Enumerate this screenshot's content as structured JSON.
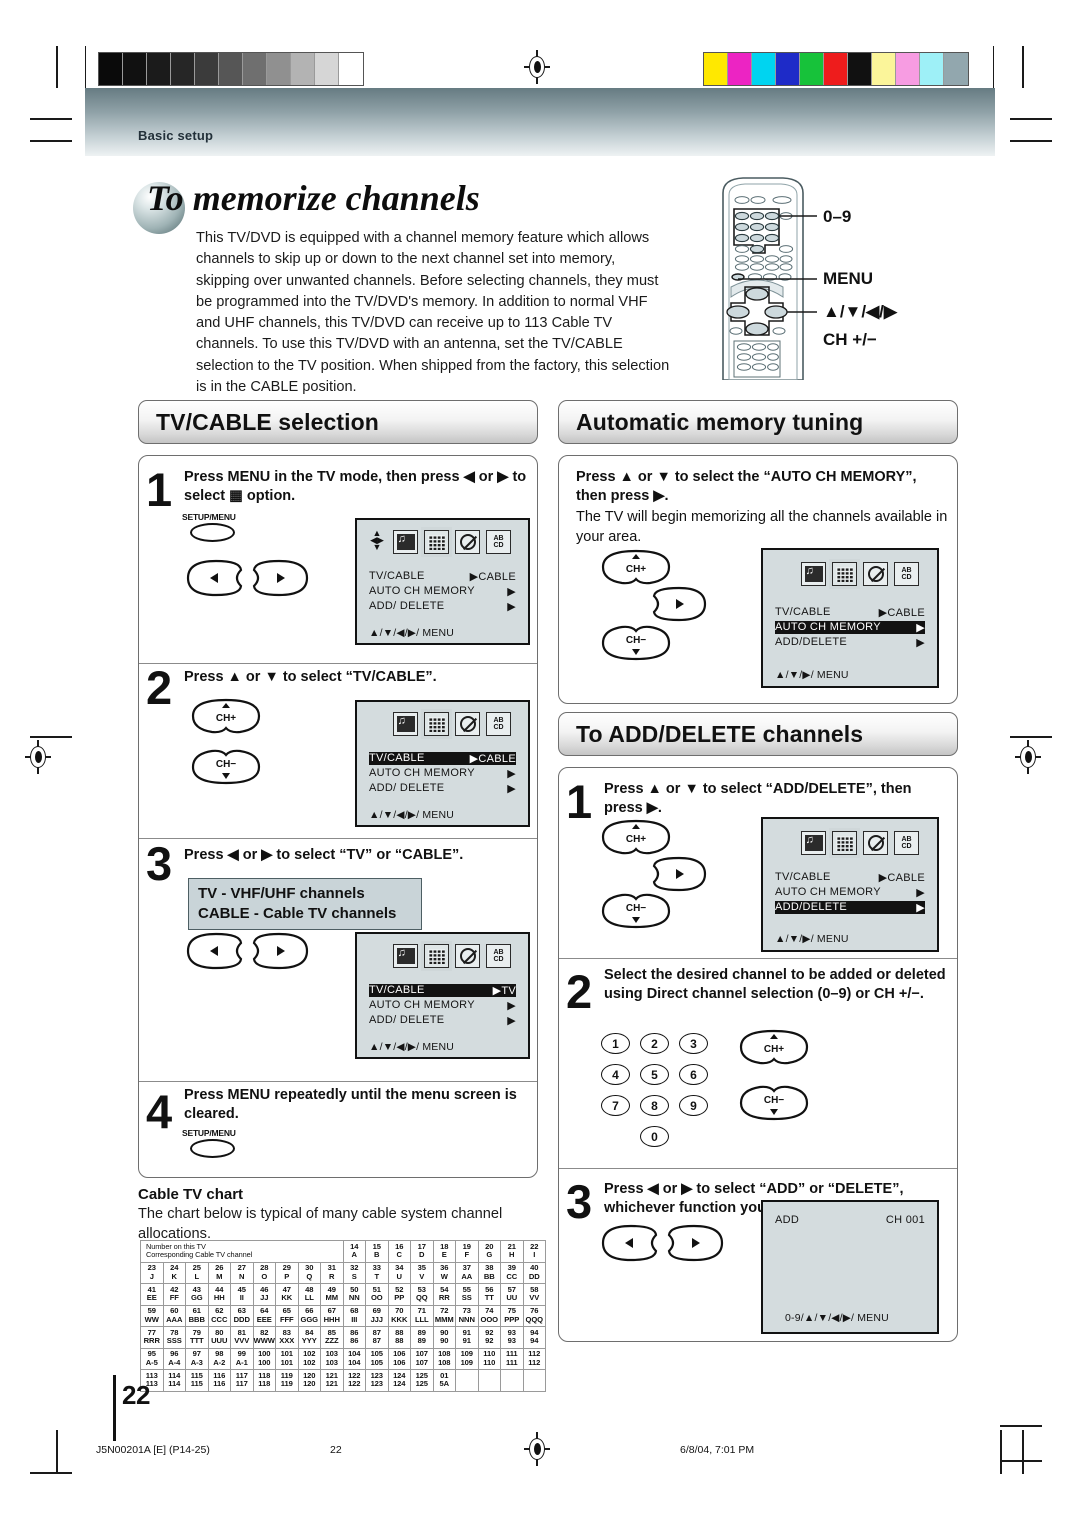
{
  "page": {
    "running_head": "Basic setup",
    "number": "22",
    "footer_left": "J5N00201A [E] (P14-25)",
    "footer_center": "22",
    "footer_right": "6/8/04, 7:01 PM"
  },
  "title": {
    "lead": "To",
    "rest": "memorize channels"
  },
  "intro": "This TV/DVD is equipped with a channel memory feature which allows channels to skip up or down to the next channel set into memory, skipping over unwanted channels. Before selecting channels, they must be programmed into the TV/DVD's memory. In addition to normal VHF and UHF channels, this TV/DVD can receive up to 113 Cable TV channels. To use this TV/DVD with an antenna, set the TV/CABLE selection to the TV position. When shipped from the factory, this selection is in the CABLE position.",
  "remote_callouts": [
    "0–9",
    "MENU",
    "▲/▼/◀/▶",
    "CH +/−"
  ],
  "sections": {
    "tv_cable": {
      "heading": "TV/CABLE selection",
      "steps": [
        {
          "num": "1",
          "text": "Press MENU in the TV mode, then press ◀ or ▶ to select ▦ option.",
          "key_label": "SETUP/MENU",
          "keys": [
            "◀",
            "▶"
          ],
          "osd": {
            "rows": [
              {
                "label": "TV/CABLE",
                "value": "▶CABLE",
                "highlight": false
              },
              {
                "label": "AUTO  CH  MEMORY",
                "value": "▶",
                "highlight": false
              },
              {
                "label": "ADD/ DELETE",
                "value": "▶",
                "highlight": false
              }
            ],
            "footer": "▲/▼/◀/▶/ MENU",
            "selected_icon": 1,
            "show_dpad": true
          }
        },
        {
          "num": "2",
          "text": "Press ▲ or ▼ to select “TV/CABLE”.",
          "keys": [
            "CH+",
            "CH−"
          ],
          "osd": {
            "rows": [
              {
                "label": "TV/CABLE",
                "value": "▶CABLE",
                "highlight": true
              },
              {
                "label": "AUTO  CH  MEMORY",
                "value": "▶",
                "highlight": false
              },
              {
                "label": "ADD/ DELETE",
                "value": "▶",
                "highlight": false
              }
            ],
            "footer": "▲/▼/◀/▶/ MENU",
            "selected_icon": 1,
            "show_dpad": false
          }
        },
        {
          "num": "3",
          "text": "Press ◀ or ▶ to select “TV” or “CABLE”.",
          "callout_lines": [
            "TV - VHF/UHF channels",
            "CABLE - Cable TV channels"
          ],
          "keys": [
            "◀",
            "▶"
          ],
          "osd": {
            "rows": [
              {
                "label": "TV/CABLE",
                "value": "▶TV",
                "highlight": true
              },
              {
                "label": "AUTO  CH  MEMORY",
                "value": "▶",
                "highlight": false
              },
              {
                "label": "ADD/ DELETE",
                "value": "▶",
                "highlight": false
              }
            ],
            "footer": "▲/▼/◀/▶/ MENU",
            "selected_icon": 1,
            "show_dpad": false
          }
        },
        {
          "num": "4",
          "text": "Press MENU repeatedly until the menu screen is cleared.",
          "key_label": "SETUP/MENU"
        }
      ]
    },
    "auto_memory": {
      "heading": "Automatic memory tuning",
      "step_bold": "Press ▲ or ▼ to select the “AUTO CH MEMORY”, then press ▶.",
      "step_normal": "The TV will begin memorizing all the channels available in your area.",
      "keys": [
        "CH+",
        "▶",
        "CH−"
      ],
      "osd": {
        "rows": [
          {
            "label": "TV/CABLE",
            "value": "▶CABLE",
            "highlight": false
          },
          {
            "label": "AUTO CH MEMORY",
            "value": "▶",
            "highlight": true
          },
          {
            "label": "ADD/DELETE",
            "value": "▶",
            "highlight": false
          }
        ],
        "footer": "▲/▼/▶/ MENU",
        "selected_icon": 1,
        "show_dpad": false
      }
    },
    "add_delete": {
      "heading": "To ADD/DELETE channels",
      "steps": [
        {
          "num": "1",
          "text": "Press ▲ or ▼ to select “ADD/DELETE”, then press ▶.",
          "keys": [
            "CH+",
            "▶",
            "CH−"
          ],
          "osd": {
            "rows": [
              {
                "label": "TV/CABLE",
                "value": "▶CABLE",
                "highlight": false
              },
              {
                "label": "AUTO CH MEMORY",
                "value": "▶",
                "highlight": false
              },
              {
                "label": "ADD/DELETE",
                "value": "▶",
                "highlight": true
              }
            ],
            "footer": "▲/▼/▶/ MENU",
            "selected_icon": 1,
            "show_dpad": false
          }
        },
        {
          "num": "2",
          "text": "Select the desired channel to be added or deleted using Direct channel selection (0–9) or CH +/−.",
          "numpad": [
            "1",
            "2",
            "3",
            "4",
            "5",
            "6",
            "7",
            "8",
            "9",
            "0"
          ],
          "keys": [
            "CH+",
            "CH−"
          ]
        },
        {
          "num": "3",
          "text": "Press ◀ or ▶ to select “ADD” or “DELETE”, whichever function you want to perform.",
          "keys": [
            "◀",
            "▶"
          ],
          "osd_simple": {
            "left": "ADD",
            "right": "CH 001",
            "footer": "0-9/▲/▼/◀/▶/ MENU"
          }
        }
      ]
    }
  },
  "cable_chart": {
    "heading": "Cable TV chart",
    "subtitle": "The chart below is typical of many cable system channel allocations.",
    "row_labels": [
      "Number on this TV",
      "Corresponding Cable TV channel"
    ],
    "rows": [
      {
        "lead": true,
        "tv": [
          "",
          "",
          "",
          "",
          "",
          "",
          "",
          "",
          "",
          "14",
          "15",
          "16",
          "17",
          "18",
          "19",
          "20",
          "21",
          "22"
        ],
        "cable": [
          "",
          "",
          "",
          "",
          "",
          "",
          "",
          "",
          "",
          "A",
          "B",
          "C",
          "D",
          "E",
          "F",
          "G",
          "H",
          "I"
        ]
      },
      {
        "lead": false,
        "tv": [
          "23",
          "24",
          "25",
          "26",
          "27",
          "28",
          "29",
          "30",
          "31",
          "32",
          "33",
          "34",
          "35",
          "36",
          "37",
          "38",
          "39",
          "40"
        ],
        "cable": [
          "J",
          "K",
          "L",
          "M",
          "N",
          "O",
          "P",
          "Q",
          "R",
          "S",
          "T",
          "U",
          "V",
          "W",
          "AA",
          "BB",
          "CC",
          "DD"
        ]
      },
      {
        "lead": false,
        "tv": [
          "41",
          "42",
          "43",
          "44",
          "45",
          "46",
          "47",
          "48",
          "49",
          "50",
          "51",
          "52",
          "53",
          "54",
          "55",
          "56",
          "57",
          "58"
        ],
        "cable": [
          "EE",
          "FF",
          "GG",
          "HH",
          "II",
          "JJ",
          "KK",
          "LL",
          "MM",
          "NN",
          "OO",
          "PP",
          "QQ",
          "RR",
          "SS",
          "TT",
          "UU",
          "VV"
        ]
      },
      {
        "lead": false,
        "tv": [
          "59",
          "60",
          "61",
          "62",
          "63",
          "64",
          "65",
          "66",
          "67",
          "68",
          "69",
          "70",
          "71",
          "72",
          "73",
          "74",
          "75",
          "76"
        ],
        "cable": [
          "WW",
          "AAA",
          "BBB",
          "CCC",
          "DDD",
          "EEE",
          "FFF",
          "GGG",
          "HHH",
          "III",
          "JJJ",
          "KKK",
          "LLL",
          "MMM",
          "NNN",
          "OOO",
          "PPP",
          "QQQ"
        ]
      },
      {
        "lead": false,
        "tv": [
          "77",
          "78",
          "79",
          "80",
          "81",
          "82",
          "83",
          "84",
          "85",
          "86",
          "87",
          "88",
          "89",
          "90",
          "91",
          "92",
          "93",
          "94"
        ],
        "cable": [
          "RRR",
          "SSS",
          "TTT",
          "UUU",
          "VVV",
          "WWW",
          "XXX",
          "YYY",
          "ZZZ",
          "86",
          "87",
          "88",
          "89",
          "90",
          "91",
          "92",
          "93",
          "94"
        ]
      },
      {
        "lead": false,
        "tv": [
          "95",
          "96",
          "97",
          "98",
          "99",
          "100",
          "101",
          "102",
          "103",
          "104",
          "105",
          "106",
          "107",
          "108",
          "109",
          "110",
          "111",
          "112"
        ],
        "cable": [
          "A-5",
          "A-4",
          "A-3",
          "A-2",
          "A-1",
          "100",
          "101",
          "102",
          "103",
          "104",
          "105",
          "106",
          "107",
          "108",
          "109",
          "110",
          "111",
          "112"
        ]
      },
      {
        "lead": false,
        "tv": [
          "113",
          "114",
          "115",
          "116",
          "117",
          "118",
          "119",
          "120",
          "121",
          "122",
          "123",
          "124",
          "125",
          "01",
          "",
          "",
          "",
          ""
        ],
        "cable": [
          "113",
          "114",
          "115",
          "116",
          "117",
          "118",
          "119",
          "120",
          "121",
          "122",
          "123",
          "124",
          "125",
          "5A",
          "",
          "",
          "",
          ""
        ]
      }
    ]
  },
  "calibration": {
    "gray_steps": [
      "#0a0a0a",
      "#111111",
      "#1b1b1b",
      "#262626",
      "#3b3b3b",
      "#565656",
      "#6f6f6f",
      "#909090",
      "#b3b3b3",
      "#d6d6d6",
      "#ffffff"
    ],
    "color_steps": [
      "#ffe800",
      "#ec24c3",
      "#00d4f0",
      "#1e2bc8",
      "#17c23a",
      "#ee1c1c",
      "#111111",
      "#fbf59a",
      "#f79ce2",
      "#9ef0f7",
      "#92a7ae"
    ]
  }
}
